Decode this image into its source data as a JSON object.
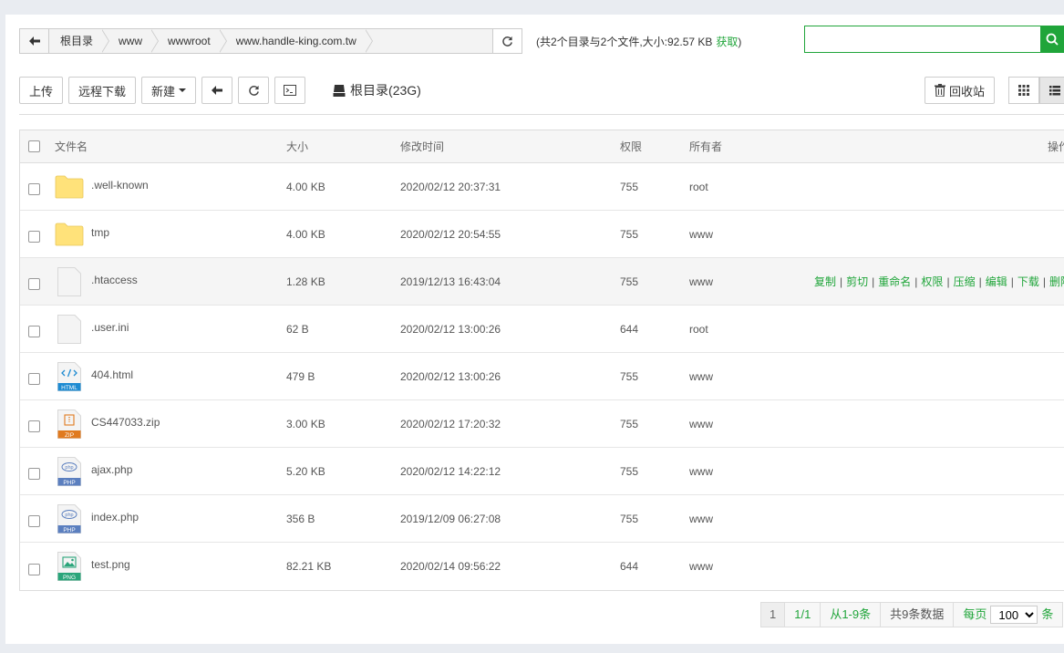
{
  "address": {
    "breadcrumbs": [
      "根目录",
      "www",
      "wwwroot",
      "www.handle-king.com.tw"
    ],
    "summary": "(共2个目录与2个文件,大小:92.57 KB",
    "summary_link": "获取",
    "summary_tail": ")"
  },
  "search": {
    "value": "",
    "placeholder": ""
  },
  "toolbar": {
    "upload": "上传",
    "remote_download": "远程下载",
    "new": "新建",
    "disk_label": "根目录(23G)",
    "recycle": "回收站"
  },
  "table": {
    "headers": {
      "name": "文件名",
      "size": "大小",
      "mtime": "修改时间",
      "perm": "权限",
      "owner": "所有者",
      "ops": "操作"
    },
    "rows": [
      {
        "name": ".well-known",
        "size": "4.00 KB",
        "mtime": "2020/02/12 20:37:31",
        "perm": "755",
        "owner": "root",
        "type": "folder"
      },
      {
        "name": "tmp",
        "size": "4.00 KB",
        "mtime": "2020/02/12 20:54:55",
        "perm": "755",
        "owner": "www",
        "type": "folder"
      },
      {
        "name": ".htaccess",
        "size": "1.28 KB",
        "mtime": "2019/12/13 16:43:04",
        "perm": "755",
        "owner": "www",
        "type": "file"
      },
      {
        "name": ".user.ini",
        "size": "62 B",
        "mtime": "2020/02/12 13:00:26",
        "perm": "644",
        "owner": "root",
        "type": "file"
      },
      {
        "name": "404.html",
        "size": "479 B",
        "mtime": "2020/02/12 13:00:26",
        "perm": "755",
        "owner": "www",
        "type": "html"
      },
      {
        "name": "CS447033.zip",
        "size": "3.00 KB",
        "mtime": "2020/02/12 17:20:32",
        "perm": "755",
        "owner": "www",
        "type": "zip"
      },
      {
        "name": "ajax.php",
        "size": "5.20 KB",
        "mtime": "2020/02/12 14:22:12",
        "perm": "755",
        "owner": "www",
        "type": "php"
      },
      {
        "name": "index.php",
        "size": "356 B",
        "mtime": "2019/12/09 06:27:08",
        "perm": "755",
        "owner": "www",
        "type": "php"
      },
      {
        "name": "test.png",
        "size": "82.21 KB",
        "mtime": "2020/02/14 09:56:22",
        "perm": "644",
        "owner": "www",
        "type": "png"
      }
    ],
    "row_ops": [
      "复制",
      "剪切",
      "重命名",
      "权限",
      "压缩",
      "编辑",
      "下载",
      "删除"
    ]
  },
  "icons": {
    "html_badge": "HTML",
    "zip_badge": "ZIP",
    "php_badge": "PHP",
    "png_badge": "PNG",
    "php_text": "php"
  },
  "pager": {
    "current": "1",
    "total_pages": "1/1",
    "range": "从1-9条",
    "total": "共9条数据",
    "per_page_label": "每页",
    "per_page_value": "100",
    "per_page_unit": "条"
  },
  "colors": {
    "accent": "#20a53a",
    "folder": "#ffe27a"
  }
}
